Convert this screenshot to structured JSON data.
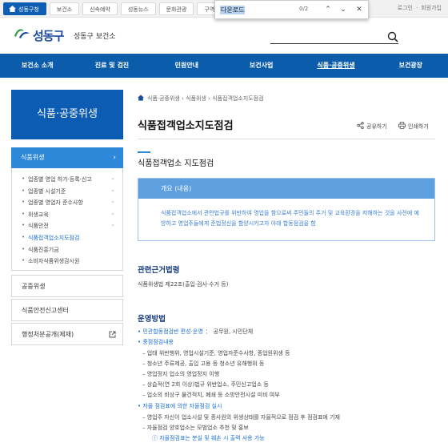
{
  "topbar": {
    "tabs": [
      "성동구청",
      "보건소",
      "신속예약",
      "성동뉴스",
      "문화관광",
      "구역"
    ],
    "links": [
      "로그인",
      "회원가입"
    ]
  },
  "findbar": {
    "query": "다운로드",
    "count": "0/2"
  },
  "header": {
    "brand": "성동구",
    "subtitle": "성동구 보건소"
  },
  "nav": {
    "items": [
      "보건소 소개",
      "진료 및 검진",
      "민원안내",
      "보건사업",
      "식품·공중위생",
      "보건광장"
    ]
  },
  "sidebar": {
    "title": "식품·공중위생",
    "section": "식품위생",
    "sub_items": [
      "업종별 영업 허가·등록·신고",
      "업종별 시설기준",
      "업종별 영업자 준수사항",
      "위생교육",
      "식품안전",
      "식품접객업소지도점검",
      "식품진흥기금",
      "소비자식품위생감시원"
    ],
    "items": [
      "공중위생",
      "식품안전신고센터",
      "행정처분공개(제재)"
    ]
  },
  "content": {
    "breadcrumb": [
      "식품·공중위생",
      "식품위생",
      "식품접객업소지도점검"
    ],
    "page_title": "식품접객업소지도점검",
    "share": "공유하기",
    "print": "인쇄하기",
    "subtitle": "식품접객업소 지도점검",
    "overview_head": "개요 (내용)",
    "overview_text": "식품접객업소에서 관련법규를 위반하여 영업을 함으로써 주민들의 주거 및 교육환경을 저해하는 것을 사전에 예방하고 영업주들에게 준법정신을 함양시키고자 아래 합동점검을 함",
    "law_heading": "관련근거법령",
    "law_text": "식품위생법 제22조(출입·검사·수거 등)",
    "method_heading": "운영방법",
    "org_label": "민관합동점검반 편성·운영",
    "org_sep": "：",
    "org_value": "공무원, 시민단체",
    "focus_label": "중점점검내용",
    "focus_items": [
      "업태 위반행위, 영업시설기준, 영업자준수사항, 종업원위생 등",
      "청소년 주류제공, 출입 고용 등 청소년 유해행위 등",
      "영업정지 업소의 영업정지 이행",
      "상습적(연 2회 이상)법규 위반업소, 주민신고업소 등",
      "업소의 비상구 물건적치, 폐쇄 등 소방안전시설 미비 여부"
    ],
    "self_label": "자율 점검표에 의한 자율점검 실시",
    "self_items": [
      "영업주 자신이 업소시설 및 종사원의 위생상태를 자율적으로 점검 후 점검표에 기재",
      "자율점검 양호업소는 모범업소 추천 및 홍보"
    ],
    "note": "자율점검표는 분실 및 훼손 시 출력 사용 가능"
  }
}
